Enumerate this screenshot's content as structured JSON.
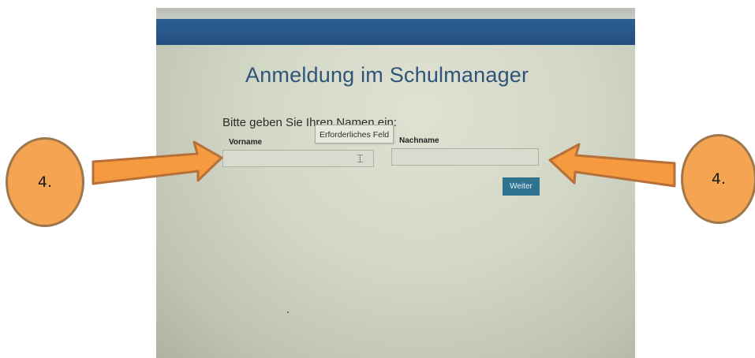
{
  "header": {
    "color": "#234f7f"
  },
  "page": {
    "title": "Anmeldung im Schulmanager",
    "prompt": "Bitte geben Sie Ihren Namen ein:"
  },
  "form": {
    "first_name_label": "Vorname",
    "first_name_value": "",
    "last_name_label": "Nachname",
    "last_name_value": "",
    "tooltip": "Erforderliches Feld",
    "submit_label": "Weiter",
    "submit_color": "#2f7391"
  },
  "annotations": {
    "left_marker": "4.",
    "right_marker": "4.",
    "marker_color": "#f5a452",
    "arrow_icon": "arrow-icon"
  }
}
